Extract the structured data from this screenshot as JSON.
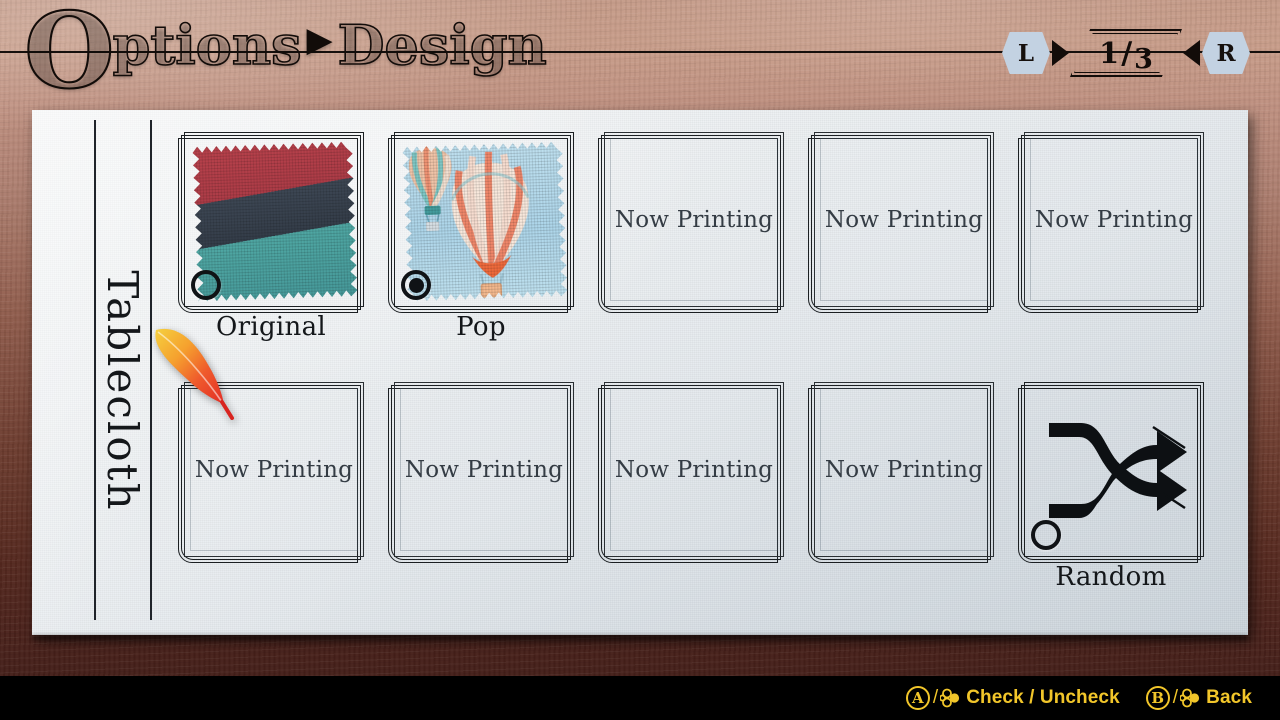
{
  "header": {
    "title_first_letter": "O",
    "title_rest": "ptions",
    "separator_icon": "▶",
    "title_section": "Design",
    "full_title": "Options ▶ Design"
  },
  "pager": {
    "left_button": "L",
    "right_button": "R",
    "current_page": "1",
    "separator": "/",
    "total_pages": "3",
    "left_arrow_icon": "triangle-left-icon",
    "right_arrow_icon": "triangle-right-icon"
  },
  "sidebar": {
    "category_label": "Tablecloth"
  },
  "cursor": {
    "icon": "quill-feather-cursor",
    "colors": {
      "tip": "#e8352a",
      "mid": "#f26a2c",
      "base": "#f1c337"
    }
  },
  "grid": {
    "rows": [
      {
        "cells": [
          {
            "type": "design",
            "label": "Original",
            "checked": false,
            "art": "fabric-swatch",
            "colors": {
              "band1": "#b9424c",
              "band2": "#3d4754",
              "band3": "#4fa7a3"
            }
          },
          {
            "type": "design",
            "label": "Pop",
            "checked": true,
            "art": "hot-air-balloons",
            "colors": {
              "sky": "#aed6ea",
              "balloon_warm": "#f0896a",
              "balloon_teal": "#7ec8c4",
              "balloon_cream": "#f7e3d3"
            }
          },
          {
            "type": "placeholder",
            "label": "Now Printing"
          },
          {
            "type": "placeholder",
            "label": "Now Printing"
          },
          {
            "type": "placeholder",
            "label": "Now Printing"
          }
        ]
      },
      {
        "cells": [
          {
            "type": "placeholder",
            "label": "Now Printing"
          },
          {
            "type": "placeholder",
            "label": "Now Printing"
          },
          {
            "type": "placeholder",
            "label": "Now Printing"
          },
          {
            "type": "placeholder",
            "label": "Now Printing"
          },
          {
            "type": "random",
            "label": "Random",
            "checked": false,
            "art": "shuffle-arrows-icon"
          }
        ]
      }
    ]
  },
  "footer": {
    "hints": [
      {
        "button": "A",
        "pointer_icon": "clover-cursor-icon",
        "label": "Check / Uncheck"
      },
      {
        "button": "B",
        "pointer_icon": "clover-cursor-icon",
        "label": "Back"
      }
    ],
    "separator": "/",
    "accent_color": "#f2c62a",
    "background_color": "#000000"
  },
  "theme": {
    "wood_top": "#c49a88",
    "wood_bottom": "#3d1b16",
    "paper": "#eef1f3",
    "ink": "#14171a"
  }
}
